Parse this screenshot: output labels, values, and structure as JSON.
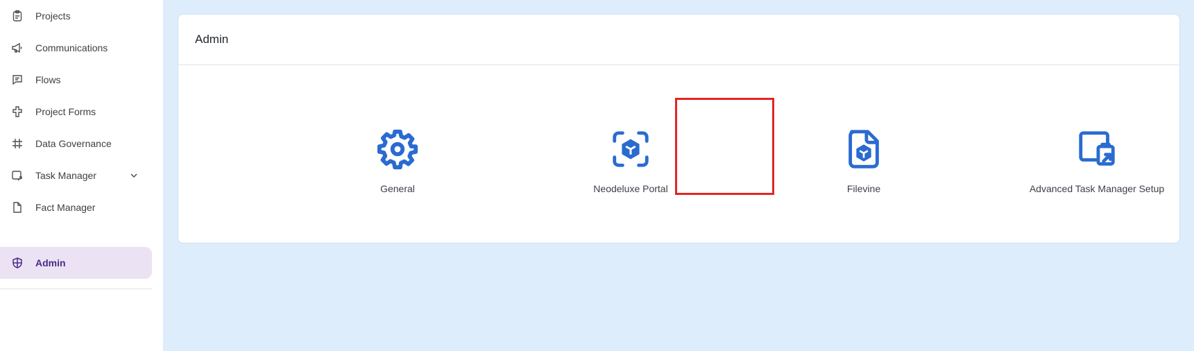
{
  "sidebar": {
    "items": [
      {
        "label": "Projects",
        "icon": "clipboard-icon"
      },
      {
        "label": "Communications",
        "icon": "megaphone-icon"
      },
      {
        "label": "Flows",
        "icon": "chat-icon"
      },
      {
        "label": "Project Forms",
        "icon": "puzzle-icon"
      },
      {
        "label": "Data Governance",
        "icon": "grid-icon"
      },
      {
        "label": "Task Manager",
        "icon": "task-external-icon"
      },
      {
        "label": "Fact Manager",
        "icon": "document-icon"
      },
      {
        "label": "Admin",
        "icon": "shield-icon",
        "active": true
      }
    ]
  },
  "main": {
    "title": "Admin",
    "tiles": [
      {
        "label": "General",
        "icon": "gear-icon"
      },
      {
        "label": "Neodeluxe Portal",
        "icon": "cube-scan-icon",
        "highlighted": true
      },
      {
        "label": "Filevine",
        "icon": "file-cube-icon"
      },
      {
        "label": "Advanced Task Manager Setup",
        "icon": "task-setup-icon"
      }
    ]
  },
  "colors": {
    "accent": "#2a6bd0",
    "active_bg": "#ebe3f3",
    "active_text": "#4a2a86",
    "main_bg": "#deedfb",
    "highlight": "#e22623"
  }
}
